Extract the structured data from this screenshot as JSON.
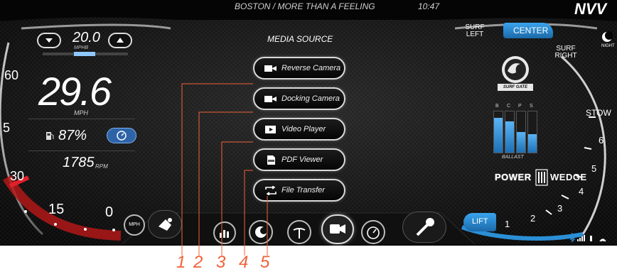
{
  "header": {
    "now_playing": "BOSTON / MORE THAN A FEELING",
    "time": "10:47",
    "brand_fragment": "NVV"
  },
  "cruise": {
    "set_speed": "20.0",
    "set_unit": "MPHB"
  },
  "speedometer": {
    "speed": "29.6",
    "speed_unit": "MPH",
    "ticks": [
      "60",
      "5",
      "30",
      "15",
      "0"
    ],
    "unit_toggle": "MPH"
  },
  "fuel": {
    "percent": "87%"
  },
  "engine": {
    "rpm": "1785",
    "rpm_unit": "RPM"
  },
  "media": {
    "title": "MEDIA SOURCE",
    "items": [
      {
        "label": "Reverse Camera",
        "icon": "video-camera-icon"
      },
      {
        "label": "Docking Camera",
        "icon": "video-camera-icon"
      },
      {
        "label": "Video Player",
        "icon": "play-icon"
      },
      {
        "label": "PDF Viewer",
        "icon": "pdf-file-icon"
      },
      {
        "label": "File Transfer",
        "icon": "transfer-icon"
      }
    ]
  },
  "surf": {
    "left": "SURF\nLEFT",
    "center": "CENTER",
    "right": "SURF\nRIGHT",
    "logo": "SURF GATE",
    "stow": "STOW",
    "scale": [
      "6",
      "5",
      "4",
      "3",
      "2",
      "1"
    ],
    "lift": "LIFT"
  },
  "ballast": {
    "title": "BALLAST",
    "columns": [
      "B",
      "C",
      "P",
      "S"
    ],
    "levels": [
      0.85,
      0.75,
      0.5,
      0.45
    ]
  },
  "wedge": {
    "logo_left": "POWER",
    "logo_right": "WEDGE"
  },
  "night": {
    "label": "NIGHT"
  },
  "callouts": [
    "1",
    "2",
    "3",
    "4",
    "5"
  ],
  "colors": {
    "accent": "#2b8fd6",
    "callout": "#f0623a",
    "danger": "#e0202a"
  }
}
